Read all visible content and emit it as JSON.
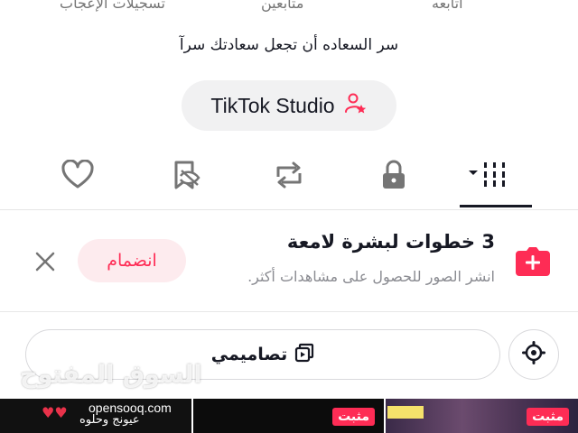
{
  "stats": {
    "likes_label": "تسجيلات الإعجاب",
    "followers_label": "متابعين",
    "following_label": "أتابعه"
  },
  "bio": "سر السعاده أن تجعل سعادتك سرآ",
  "studio_button": {
    "label": "TikTok Studio",
    "icon": "person-star-icon"
  },
  "tabs": [
    {
      "name": "posts",
      "icon": "grid-icon",
      "active": true
    },
    {
      "name": "private",
      "icon": "lock-icon"
    },
    {
      "name": "reposts",
      "icon": "repost-icon"
    },
    {
      "name": "favorites",
      "icon": "bookmark-hidden-icon"
    },
    {
      "name": "liked",
      "icon": "heart-icon"
    }
  ],
  "promo": {
    "title": "3 خطوات لبشرة لامعة",
    "subtitle": "انشر الصور للحصول على مشاهدات أكثر.",
    "join_label": "انضمام",
    "icon": "add-icon"
  },
  "templates_button": {
    "label": "تصاميمي",
    "icon": "templates-icon"
  },
  "settings_icon": "gear-icon",
  "watermark": "السوق المفتوح",
  "thumbnails": [
    {
      "site": "opensooq.com",
      "caption": "عيونج وحلوه",
      "pinned": false
    },
    {
      "pinned": true,
      "badge": "مثبت"
    },
    {
      "pinned": true,
      "badge": "مثبت"
    }
  ],
  "colors": {
    "accent": "#fe2c55",
    "text": "#161823",
    "muted": "#8a8b91"
  }
}
